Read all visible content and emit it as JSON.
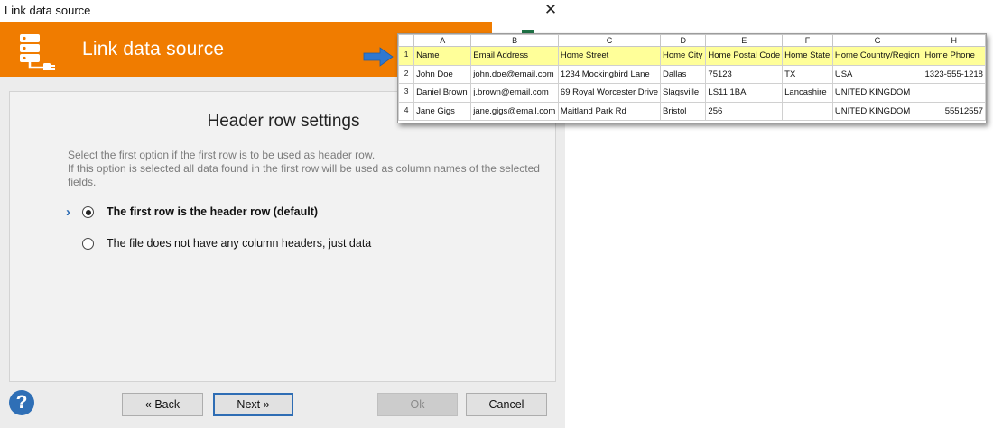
{
  "window": {
    "title": "Link data source",
    "close_glyph": "✕"
  },
  "banner": {
    "title": "Link data source",
    "logo_icon": "database-plug-icon",
    "color": "#f07c00"
  },
  "panel": {
    "heading": "Header row settings",
    "description_line1": "Select the first option if the first row is to be used as header row.",
    "description_line2": "If this option is selected all data found in the first row will be used as column names of the selected fields.",
    "options": [
      {
        "label": "The first row is the header row (default)",
        "checked": true
      },
      {
        "label": "The file does not have any column headers, just data",
        "checked": false
      }
    ]
  },
  "buttons": {
    "help": "?",
    "back": "« Back",
    "next": "Next »",
    "ok": "Ok",
    "cancel": "Cancel"
  },
  "spreadsheet": {
    "column_letters": [
      "A",
      "B",
      "C",
      "D",
      "E",
      "F",
      "G",
      "H"
    ],
    "row_numbers": [
      "1",
      "2",
      "3",
      "4"
    ],
    "header_row": [
      "Name",
      "Email Address",
      "Home Street",
      "Home City",
      "Home Postal Code",
      "Home State",
      "Home Country/Region",
      "Home Phone"
    ],
    "rows": [
      [
        "John Doe",
        "john.doe@email.com",
        "1234 Mockingbird Lane",
        "Dallas",
        "75123",
        "TX",
        "USA",
        "1323-555-1218"
      ],
      [
        "Daniel Brown",
        "j.brown@email.com",
        "69 Royal Worcester Drive",
        "Slagsville",
        "LS11 1BA",
        "Lancashire",
        "UNITED KINGDOM",
        ""
      ],
      [
        "Jane Gigs",
        "jane.gigs@email.com",
        "Maitland Park Rd",
        "Bristol",
        "256",
        "",
        "UNITED KINGDOM",
        "55512557"
      ]
    ],
    "header_highlight": "#ffff99"
  }
}
